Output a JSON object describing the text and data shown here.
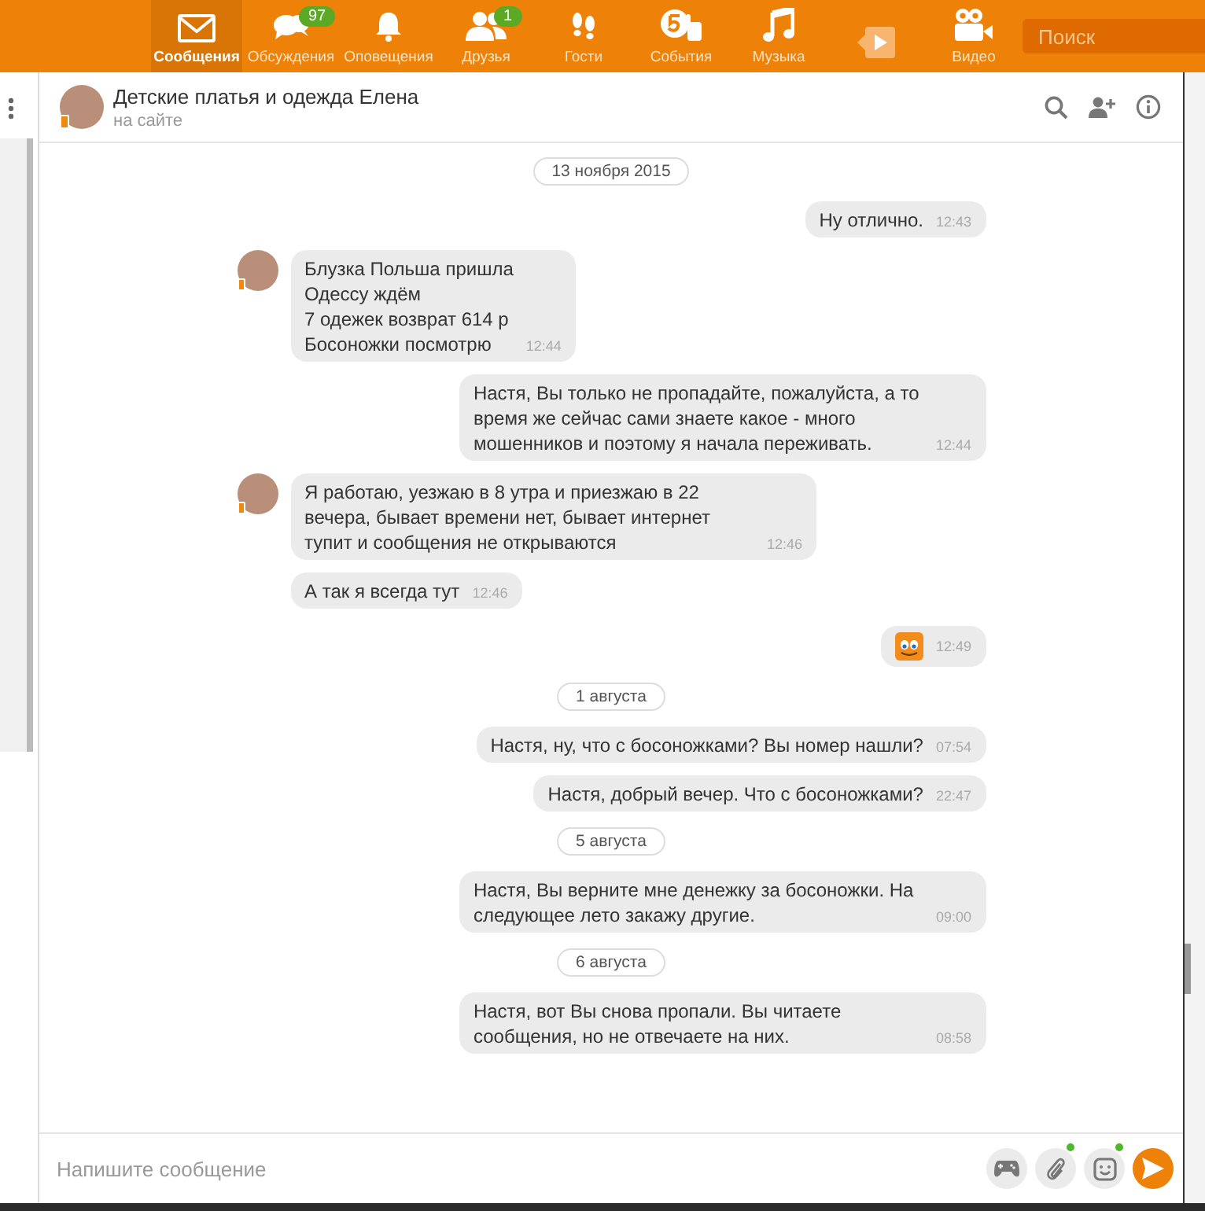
{
  "nav": {
    "items": [
      {
        "label": "Сообщения",
        "selected": true
      },
      {
        "label": "Обсуждения",
        "selected": false,
        "badge": "97"
      },
      {
        "label": "Оповещения",
        "selected": false
      },
      {
        "label": "Друзья",
        "selected": false,
        "badge": "1"
      },
      {
        "label": "Гости",
        "selected": false
      },
      {
        "label": "События",
        "selected": false
      },
      {
        "label": "Музыка",
        "selected": false
      },
      {
        "selected": false
      },
      {
        "label": "Видео",
        "selected": false
      }
    ],
    "search": {
      "placeholder": "Поиск"
    }
  },
  "chat": {
    "title": "Детские платья и одежда Елена",
    "status": "на сайте"
  },
  "messages": [
    {
      "kind": "date",
      "text": "13 ноября 2015"
    },
    {
      "kind": "outgoing",
      "text": "Ну отлично.",
      "time": "12:43"
    },
    {
      "kind": "incoming",
      "avatar": true,
      "text": "Блузка Польша пришла\nОдессу ждём\n7 одежек возврат 614 р\nБосоножки посмотрю",
      "time": "12:44"
    },
    {
      "kind": "outgoing",
      "text": "Настя, Вы только не пропадайте, пожалуйста, а то время же сейчас сами знаете какое - много мошенников и поэтому я начала переживать.",
      "time": "12:44"
    },
    {
      "kind": "incoming",
      "avatar": true,
      "text": "Я работаю, уезжаю в 8 утра и приезжаю в 22 вечера, бывает времени нет, бывает интернет тупит и сообщения не открываются",
      "time": "12:46"
    },
    {
      "kind": "incoming",
      "avatar": false,
      "text": "А так я всегда тут",
      "time": "12:46"
    },
    {
      "kind": "smiley",
      "time": "12:49"
    },
    {
      "kind": "date",
      "text": "1 августа"
    },
    {
      "kind": "outgoing",
      "text": "Настя, ну, что с босоножками? Вы номер нашли?",
      "time": "07:54"
    },
    {
      "kind": "outgoing",
      "text": "Настя, добрый вечер. Что с босоножками?",
      "time": "22:47"
    },
    {
      "kind": "date",
      "text": "5 августа"
    },
    {
      "kind": "outgoing",
      "text": "Настя, Вы верните мне денежку за босоножки. На следующее лето закажу другие.",
      "time": "09:00"
    },
    {
      "kind": "date",
      "text": "6 августа"
    },
    {
      "kind": "outgoing",
      "text": "Настя, вот Вы снова пропали. Вы читаете сообщения, но не отвечаете на них.",
      "time": "08:58"
    }
  ],
  "composer": {
    "placeholder": "Напишите сообщение"
  }
}
